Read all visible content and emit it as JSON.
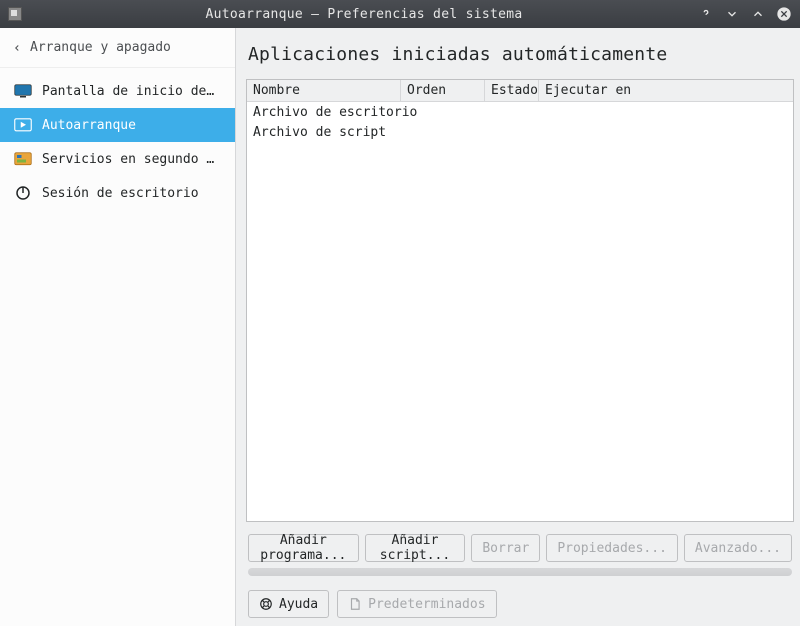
{
  "window": {
    "title": "Autoarranque — Preferencias del sistema"
  },
  "sidebar": {
    "back_label": "Arranque y apagado",
    "items": [
      {
        "label": "Pantalla de inicio de s…",
        "selected": false
      },
      {
        "label": "Autoarranque",
        "selected": true
      },
      {
        "label": "Servicios en segundo pl…",
        "selected": false
      },
      {
        "label": "Sesión de escritorio",
        "selected": false
      }
    ]
  },
  "main": {
    "title": "Aplicaciones iniciadas automáticamente",
    "columns": {
      "name": "Nombre",
      "order": "Orden",
      "status": "Estado",
      "run_on": "Ejecutar en"
    },
    "rows": [
      {
        "name": "Archivo de escritorio"
      },
      {
        "name": "Archivo de script"
      }
    ],
    "buttons": {
      "add_program": "Añadir programa...",
      "add_script": "Añadir script...",
      "remove": "Borrar",
      "properties": "Propiedades...",
      "advanced": "Avanzado..."
    }
  },
  "footer": {
    "help": "Ayuda",
    "defaults": "Predeterminados"
  }
}
